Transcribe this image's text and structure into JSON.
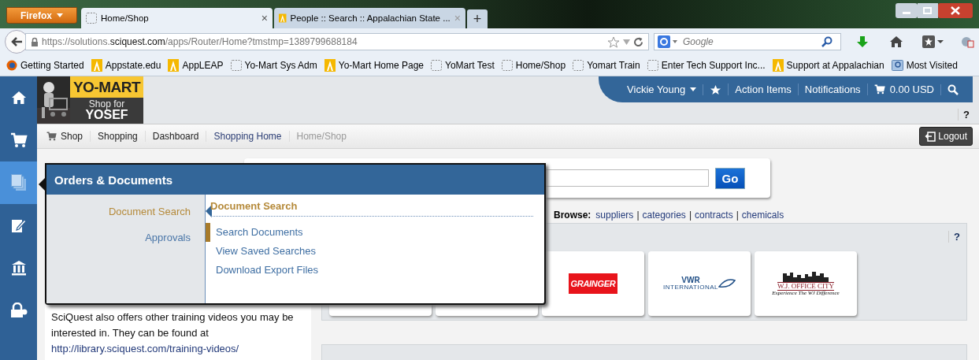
{
  "browser": {
    "menu_button": "Firefox",
    "tabs": [
      {
        "title": "Home/Shop",
        "kind": "page",
        "selected": true,
        "close": "×"
      },
      {
        "title": "People :: Search :: Appalachian State ...",
        "kind": "a",
        "selected": false,
        "close": "×"
      }
    ],
    "new_tab": "+",
    "url": "https://solutions.**sciquest.com**/apps/Router/Home?tmstmp=1389799688184",
    "search": {
      "placeholder": "Google"
    },
    "bookmarks": [
      {
        "label": "Getting Started",
        "kind": "firefox"
      },
      {
        "label": "Appstate.edu",
        "kind": "a"
      },
      {
        "label": "AppLEAP",
        "kind": "a"
      },
      {
        "label": "Yo-Mart Sys Adm",
        "kind": "page"
      },
      {
        "label": "Yo-Mart Home Page",
        "kind": "a"
      },
      {
        "label": "YoMart Test",
        "kind": "page"
      },
      {
        "label": "Home/Shop",
        "kind": "page"
      },
      {
        "label": "Yomart Train",
        "kind": "page"
      },
      {
        "label": "Enter Tech Support Inc...",
        "kind": "page"
      },
      {
        "label": "Support at Appalachian",
        "kind": "a"
      },
      {
        "label": "Most Visited",
        "kind": "folder"
      }
    ]
  },
  "sidebar": {
    "items": [
      {
        "kind": "home",
        "selected": false
      },
      {
        "kind": "cart",
        "selected": false
      },
      {
        "kind": "documents",
        "selected": true
      },
      {
        "kind": "edit",
        "selected": false
      },
      {
        "kind": "bank",
        "selected": false
      },
      {
        "kind": "lock",
        "selected": false
      }
    ]
  },
  "logo": {
    "title": "YO-MART",
    "line_1": "Shop for",
    "line_2": "YOSEF"
  },
  "topbar": {
    "user": "Vickie Young",
    "action_items": "Action Items",
    "notifications": "Notifications",
    "cart_total": "0.00 USD"
  },
  "help": "?",
  "breadcrumb": [
    {
      "label": "Shop",
      "kind": "link"
    },
    {
      "label": "Shopping",
      "kind": "link"
    },
    {
      "label": "Dashboard",
      "kind": "link"
    },
    {
      "label": "Shopping Home",
      "kind": "visited"
    },
    {
      "label": "Home/Shop",
      "kind": "current"
    }
  ],
  "logout": "Logout",
  "search_card": {
    "button": "Go"
  },
  "browse": {
    "label": "Browse:",
    "separator": "|",
    "links": [
      "suppliers",
      "categories",
      "contracts",
      "chemicals"
    ]
  },
  "info_text": "SciQuest also offers other training videos you may be interested in. They can be found at",
  "info_link": "http://library.sciquest.com/training-videos/",
  "suppliers": {
    "help": "?",
    "cards": [
      {
        "kind": "blank"
      },
      {
        "kind": "blank"
      },
      {
        "kind": "grainger",
        "name": "GRAINGER"
      },
      {
        "kind": "vwr",
        "name": "VWR",
        "subtitle": "INTERNATIONAL"
      },
      {
        "kind": "wj",
        "name": "W.J. OFFICE CITY",
        "subtitle": "Experience The WJ Difference"
      }
    ]
  },
  "flyout": {
    "title": "Orders & Documents",
    "sections": [
      {
        "label": "Document Search",
        "selected": true
      },
      {
        "label": "Approvals",
        "selected": false
      }
    ],
    "heading": "Document Search",
    "links": [
      {
        "label": "Search Documents",
        "selected": true
      },
      {
        "label": "View Saved Searches",
        "selected": false
      },
      {
        "label": "Download Export Files",
        "selected": false
      }
    ]
  }
}
